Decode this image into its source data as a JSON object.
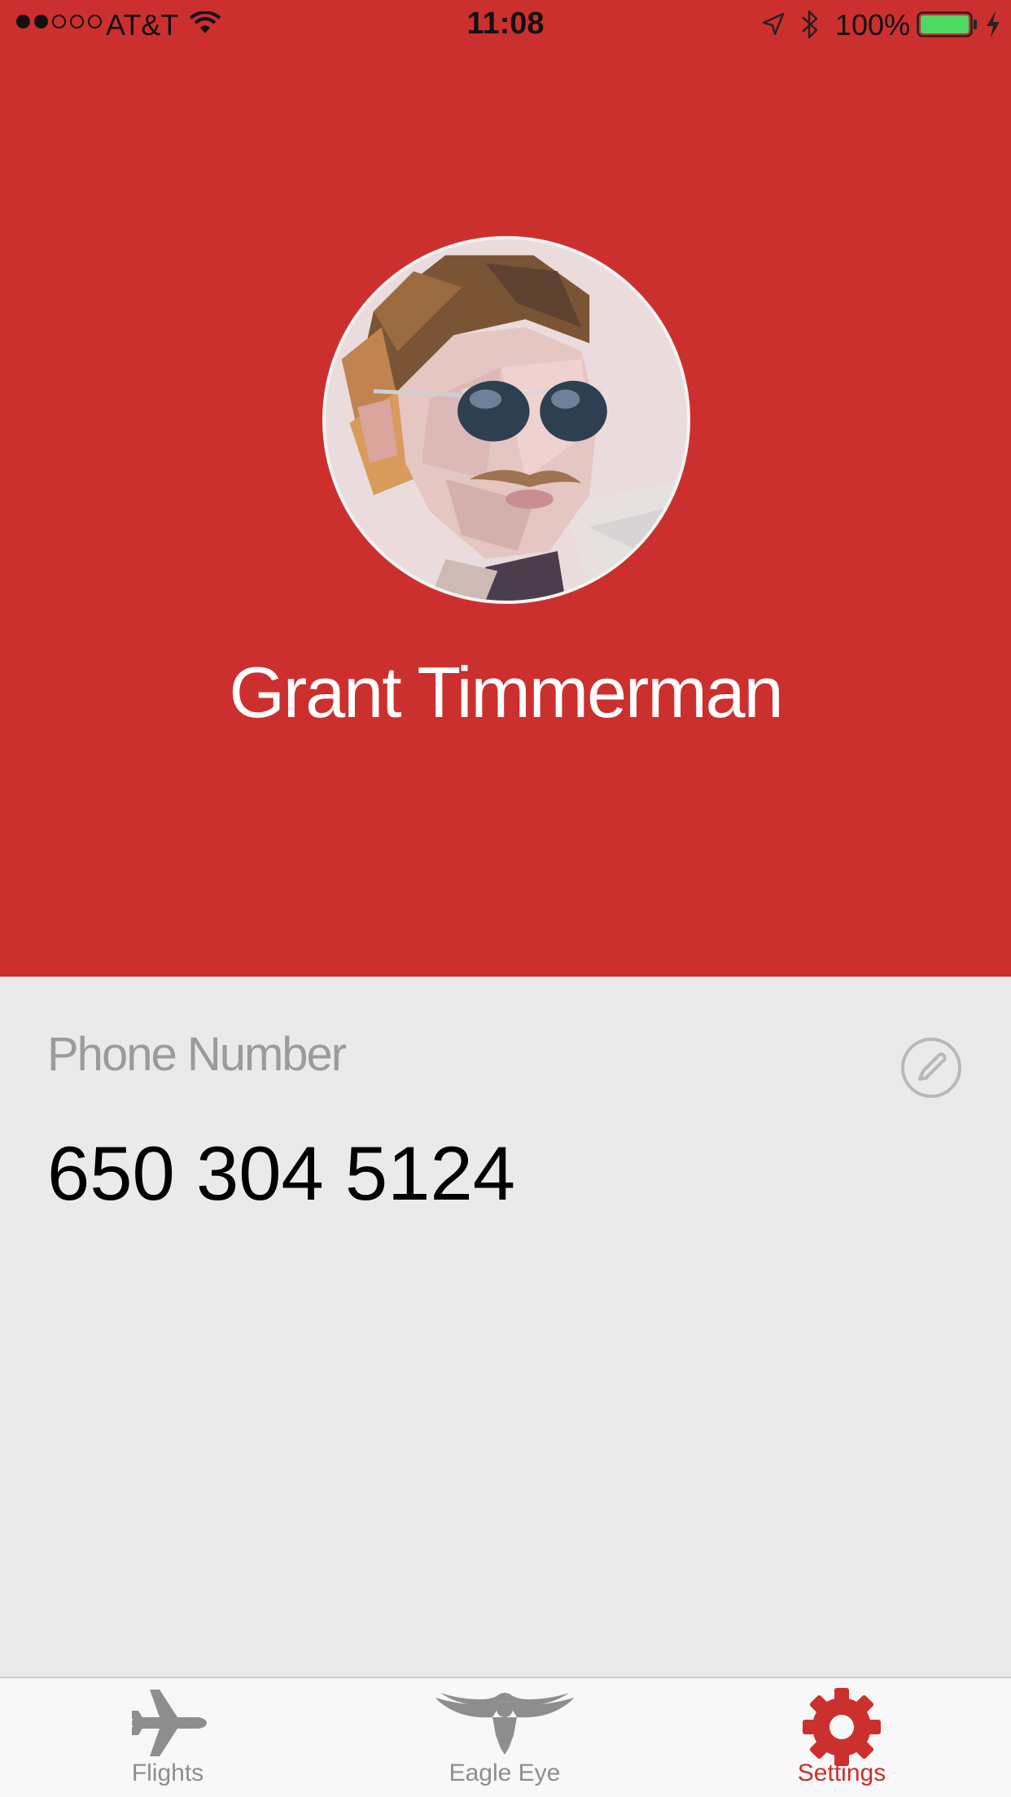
{
  "status_bar": {
    "signal_strength": "2 of 5",
    "carrier": "AT&T",
    "time": "11:08",
    "battery": "100%",
    "charging": true
  },
  "profile": {
    "name": "Grant Timmerman"
  },
  "phone": {
    "label": "Phone Number",
    "value": "650 304 5124"
  },
  "tab_bar": {
    "active_tab": "Settings",
    "tabs": [
      {
        "label": "Flights",
        "icon": "airplane-icon"
      },
      {
        "label": "Eagle Eye",
        "icon": "eagle-icon"
      },
      {
        "label": "Settings",
        "icon": "gear-icon"
      }
    ]
  },
  "colors": {
    "brand_red": "#cc302e",
    "background_gray": "#eaeaea",
    "inactive_gray": "#8e8e8e",
    "battery_green": "#4cd964"
  }
}
